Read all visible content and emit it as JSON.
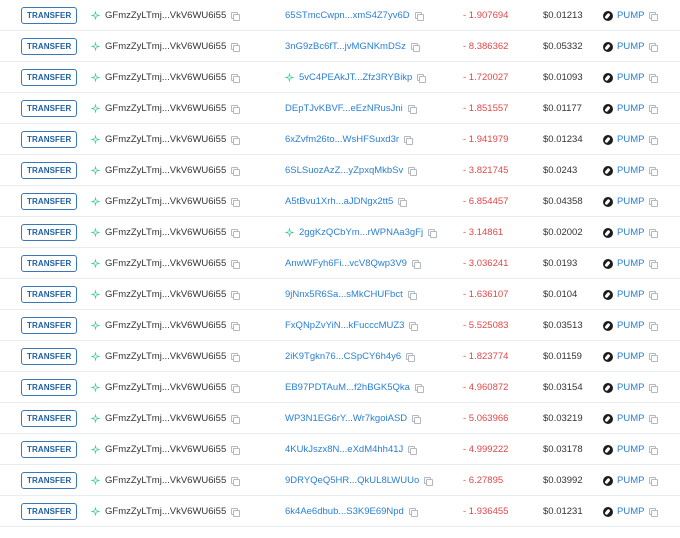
{
  "colors": {
    "badge_border": "#3a78b8",
    "badge_text": "#1f5fa5",
    "link": "#2a7fd4",
    "amount_negative": "#e04848",
    "star_green": "#3fd2a0"
  },
  "rows": [
    {
      "type": "TRANSFER",
      "from": "GFmzZyLTmj...VkV6WU6i55",
      "to": "65STmcCwpn...xmS4Z7yv6D",
      "to_icon": false,
      "amount": "- 1.907694",
      "price": "$0.01213",
      "token": "PUMP"
    },
    {
      "type": "TRANSFER",
      "from": "GFmzZyLTmj...VkV6WU6i55",
      "to": "3nG9zBc6fT...jvMGNKmDSz",
      "to_icon": false,
      "amount": "- 8.386362",
      "price": "$0.05332",
      "token": "PUMP"
    },
    {
      "type": "TRANSFER",
      "from": "GFmzZyLTmj...VkV6WU6i55",
      "to": "5vC4PEAkJT...Zfz3RYBikp",
      "to_icon": true,
      "amount": "- 1.720027",
      "price": "$0.01093",
      "token": "PUMP"
    },
    {
      "type": "TRANSFER",
      "from": "GFmzZyLTmj...VkV6WU6i55",
      "to": "DEpTJvKBVF...eEzNRusJni",
      "to_icon": false,
      "amount": "- 1.851557",
      "price": "$0.01177",
      "token": "PUMP"
    },
    {
      "type": "TRANSFER",
      "from": "GFmzZyLTmj...VkV6WU6i55",
      "to": "6xZvfm26to...WsHFSuxd3r",
      "to_icon": false,
      "amount": "- 1.941979",
      "price": "$0.01234",
      "token": "PUMP"
    },
    {
      "type": "TRANSFER",
      "from": "GFmzZyLTmj...VkV6WU6i55",
      "to": "6SLSuozAzZ...yZpxqMkbSv",
      "to_icon": false,
      "amount": "- 3.821745",
      "price": "$0.0243",
      "token": "PUMP"
    },
    {
      "type": "TRANSFER",
      "from": "GFmzZyLTmj...VkV6WU6i55",
      "to": "A5tBvu1Xrh...aJDNgx2tt5",
      "to_icon": false,
      "amount": "- 6.854457",
      "price": "$0.04358",
      "token": "PUMP"
    },
    {
      "type": "TRANSFER",
      "from": "GFmzZyLTmj...VkV6WU6i55",
      "to": "2ggKzQCbYm...rWPNAa3gFj",
      "to_icon": true,
      "amount": "- 3.14861",
      "price": "$0.02002",
      "token": "PUMP"
    },
    {
      "type": "TRANSFER",
      "from": "GFmzZyLTmj...VkV6WU6i55",
      "to": "AnwWFyh6Fi...vcV8Qwp3V9",
      "to_icon": false,
      "amount": "- 3.036241",
      "price": "$0.0193",
      "token": "PUMP"
    },
    {
      "type": "TRANSFER",
      "from": "GFmzZyLTmj...VkV6WU6i55",
      "to": "9jNnx5R6Sa...sMkCHUFbct",
      "to_icon": false,
      "amount": "- 1.636107",
      "price": "$0.0104",
      "token": "PUMP"
    },
    {
      "type": "TRANSFER",
      "from": "GFmzZyLTmj...VkV6WU6i55",
      "to": "FxQNpZvYiN...kFucccMUZ3",
      "to_icon": false,
      "amount": "- 5.525083",
      "price": "$0.03513",
      "token": "PUMP"
    },
    {
      "type": "TRANSFER",
      "from": "GFmzZyLTmj...VkV6WU6i55",
      "to": "2iK9Tgkn76...CSpCY6h4y6",
      "to_icon": false,
      "amount": "- 1.823774",
      "price": "$0.01159",
      "token": "PUMP"
    },
    {
      "type": "TRANSFER",
      "from": "GFmzZyLTmj...VkV6WU6i55",
      "to": "EB97PDTAuM...f2hBGK5Qka",
      "to_icon": false,
      "amount": "- 4.960872",
      "price": "$0.03154",
      "token": "PUMP"
    },
    {
      "type": "TRANSFER",
      "from": "GFmzZyLTmj...VkV6WU6i55",
      "to": "WP3N1EG6rY...Wr7kgoiASD",
      "to_icon": false,
      "amount": "- 5.063966",
      "price": "$0.03219",
      "token": "PUMP"
    },
    {
      "type": "TRANSFER",
      "from": "GFmzZyLTmj...VkV6WU6i55",
      "to": "4KUkJszx8N...eXdM4hh41J",
      "to_icon": false,
      "amount": "- 4.999222",
      "price": "$0.03178",
      "token": "PUMP"
    },
    {
      "type": "TRANSFER",
      "from": "GFmzZyLTmj...VkV6WU6i55",
      "to": "9DRYQeQ5HR...QkUL8LWUUo",
      "to_icon": false,
      "amount": "- 6.27895",
      "price": "$0.03992",
      "token": "PUMP"
    },
    {
      "type": "TRANSFER",
      "from": "GFmzZyLTmj...VkV6WU6i55",
      "to": "6k4Ae6dbub...S3K9E69Npd",
      "to_icon": false,
      "amount": "- 1.936455",
      "price": "$0.01231",
      "token": "PUMP"
    }
  ]
}
